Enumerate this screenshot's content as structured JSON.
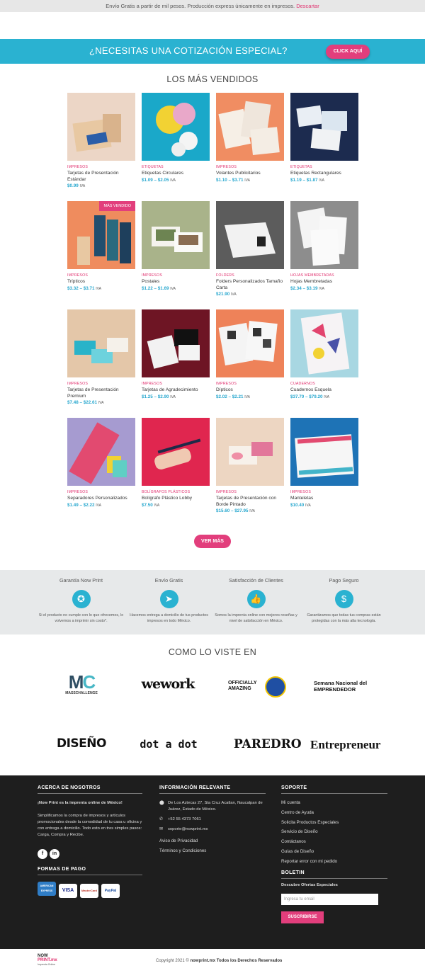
{
  "topbar": {
    "text": "Envío Gratis a partir de mil pesos. Producción express únicamente en impresos.",
    "link": "Descartar"
  },
  "cta": {
    "title": "¿NECESITAS UNA COTIZACIÓN ESPECIAL?",
    "button": "CLICK AQUÍ"
  },
  "bestsellers": {
    "title": "LOS MÁS VENDIDOS",
    "products": [
      {
        "cat": "IMPRESOS",
        "name": "Tarjetas de Presentación Estándar",
        "price": "$0.99",
        "iva": "IVA"
      },
      {
        "cat": "ETIQUETAS",
        "name": "Etiquetas Circulares",
        "price": "$1.09 – $2.05",
        "iva": "IVA"
      },
      {
        "cat": "IMPRESOS",
        "name": "Volantes Publicitarios",
        "price": "$1.10 – $3.71",
        "iva": "IVA"
      },
      {
        "cat": "ETIQUETAS",
        "name": "Etiquetas Rectangulares",
        "price": "$1.19 – $1.87",
        "iva": "IVA"
      },
      {
        "cat": "IMPRESOS",
        "name": "Trípticos",
        "price": "$3.32 – $3.71",
        "iva": "IVA",
        "badge": "MÁS VENDIDO"
      },
      {
        "cat": "IMPRESOS",
        "name": "Postales",
        "price": "$1.22 – $1.69",
        "iva": "IVA"
      },
      {
        "cat": "FOLDERS",
        "name": "Folders Personalizados Tamaño Carta",
        "price": "$21.90",
        "iva": "IVA"
      },
      {
        "cat": "HOJAS MEMBRETADAS",
        "name": "Hojas Membretadas",
        "price": "$2.34 – $3.19",
        "iva": "IVA"
      },
      {
        "cat": "IMPRESOS",
        "name": "Tarjetas de Presentación Premium",
        "price": "$7.48 – $22.61",
        "iva": "IVA"
      },
      {
        "cat": "IMPRESOS",
        "name": "Tarjetas de Agradecimiento",
        "price": "$1.25 – $2.90",
        "iva": "IVA"
      },
      {
        "cat": "IMPRESOS",
        "name": "Dípticos",
        "price": "$2.02 – $2.21",
        "iva": "IVA"
      },
      {
        "cat": "CUADERNOS",
        "name": "Cuadernos Esquela",
        "price": "$37.70 – $79.20",
        "iva": "IVA"
      },
      {
        "cat": "IMPRESOS",
        "name": "Separadores Personalizados",
        "price": "$1.49 – $2.22",
        "iva": "IVA"
      },
      {
        "cat": "BOLÍGRAFOS PLÁSTICOS",
        "name": "Bolígrafo Plástico Lobby",
        "price": "$7.50",
        "iva": "IVA"
      },
      {
        "cat": "IMPRESOS",
        "name": "Tarjetas de Presentación con Borde Pintado",
        "price": "$15.60 – $27.95",
        "iva": "IVA"
      },
      {
        "cat": "IMPRESOS",
        "name": "Manteletas",
        "price": "$10.40",
        "iva": "IVA"
      }
    ],
    "more_button": "VER MÁS"
  },
  "features": [
    {
      "title": "Garantía Now Print",
      "icon": "award-icon",
      "text": "Si el producto no cumple con lo que ofrecemos, lo volvemos a imprimir sin costo*."
    },
    {
      "title": "Envío Gratis",
      "icon": "paper-plane-icon",
      "text": "Hacemos entrega a domicilio de tus productos impresos en todo México."
    },
    {
      "title": "Satisfacción de Clientes",
      "icon": "thumbs-up-icon",
      "text": "Somos la imprenta online con mejores reseñas y nivel de satisfacción en México."
    },
    {
      "title": "Pago Seguro",
      "icon": "money-icon",
      "text": "Garantizamos que todas tus compras están protegidas con la más alta tecnología."
    }
  ],
  "press": {
    "title": "COMO LO VISTE EN",
    "logos": [
      "MASSCHALLENGE",
      "wework",
      "OFFICIALLY AMAZING",
      "Semana Nacional del EMPRENDEDOR",
      "DISEÑO",
      "dot a dot",
      "PAREDRO",
      "Entrepreneur"
    ]
  },
  "footer": {
    "about": {
      "title": "ACERCA DE NOSOTROS",
      "lead": "¡Now Print es la imprenta online de México!",
      "text": "Simplificamos la compra de impresos y artículos promocionales desde la comodidad de tu casa u oficina y con entrega a domicilio. Todo esto en tres simples pasos: Carga, Compra y Recibe.",
      "payments_title": "FORMAS DE PAGO",
      "payments": [
        "AMERICAN EXPRESS",
        "VISA",
        "MasterCard",
        "PayPal"
      ]
    },
    "info": {
      "title": "INFORMACIÓN RELEVANTE",
      "address": "De Los Aztecas 27, Sta Cruz Acatlan, Naucalpan de Juárez, Estado de México.",
      "phone": "+52 55 4373 7061",
      "email": "soporte@nowprint.mx",
      "links": [
        "Aviso de Privacidad",
        "Términos y Condiciones"
      ]
    },
    "support": {
      "title": "SOPORTE",
      "links": [
        "Mi cuenta",
        "Centro de Ayuda",
        "Solicita Productos Especiales",
        "Servicio de Diseño",
        "Contáctanos",
        "Guías de Diseño",
        "Reportar error con mi pedido"
      ],
      "newsletter_title": "BOLETIN",
      "newsletter_lead": "Descubre Ofertas Especiales",
      "email_placeholder": "Ingresa tu email",
      "subscribe": "SUSCRIBIRSE"
    }
  },
  "bottom": {
    "logo_line1": "NOW",
    "logo_line2": "PRINT.mx",
    "logo_tag": "Imprenta Online",
    "copyright": "Copyright 2021 ©",
    "copyright_bold": "nowprint.mx Todos los Derechos Reservados"
  },
  "colors": {
    "accent": "#2ab2d1",
    "pink": "#e23e7c",
    "footer": "#1e1e1e"
  }
}
